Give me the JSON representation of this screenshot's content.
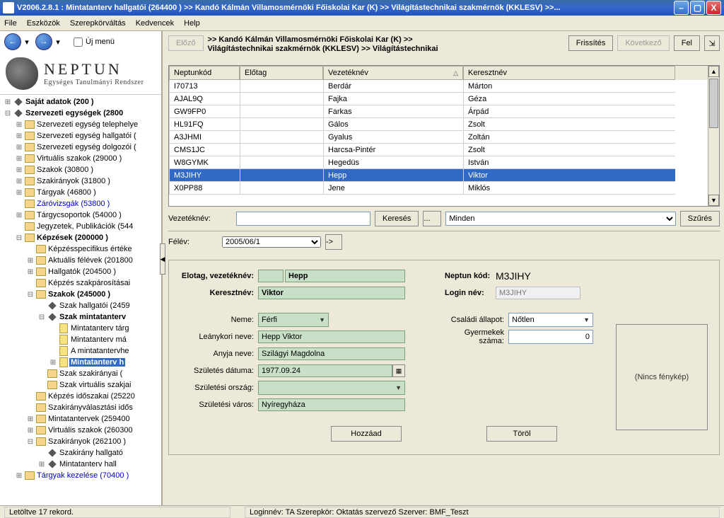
{
  "title": "V2006.2.8.1 : Mintatanterv hallgatói (264400  )   >> Kandó Kálmán Villamosmérnöki Főiskolai Kar (K) >> Világítástechnikai szakmérnök (KKLESV) >>...",
  "menu": {
    "file": "File",
    "tools": "Eszközök",
    "roles": "Szerepkörváltás",
    "fav": "Kedvencek",
    "help": "Help"
  },
  "ujmenu": "Új menü",
  "brand": {
    "name": "NEPTUN",
    "sub": "Egységes Tanulmányi Rendszer"
  },
  "toolbar": {
    "prev": "Előző",
    "refresh": "Frissítés",
    "next": "Következő",
    "up": "Fel"
  },
  "crumbs": {
    "l1": ">> Kandó Kálmán Villamosmérnöki Főiskolai Kar (K) >>",
    "l2": "Világítástechnikai szakmérnök (KKLESV) >> Világítástechnikai"
  },
  "table": {
    "cols": {
      "c0": "Neptunkód",
      "c1": "Előtag",
      "c2": "Vezetéknév",
      "c3": "Keresztnév"
    },
    "rows": [
      {
        "c0": "I70713",
        "c1": "",
        "c2": "Berdár",
        "c3": "Márton"
      },
      {
        "c0": "AJAL9Q",
        "c1": "",
        "c2": "Fajka",
        "c3": "Géza"
      },
      {
        "c0": "GW9FP0",
        "c1": "",
        "c2": "Farkas",
        "c3": "Árpád"
      },
      {
        "c0": "HL91FQ",
        "c1": "",
        "c2": "Gálos",
        "c3": "Zsolt"
      },
      {
        "c0": "A3JHMI",
        "c1": "",
        "c2": "Gyalus",
        "c3": "Zoltán"
      },
      {
        "c0": "CMS1JC",
        "c1": "",
        "c2": "Harcsa-Pintér",
        "c3": "Zsolt"
      },
      {
        "c0": "W8GYMK",
        "c1": "",
        "c2": "Hegedüs",
        "c3": "István"
      },
      {
        "c0": "M3JIHY",
        "c1": "",
        "c2": "Hepp",
        "c3": "Viktor",
        "sel": true
      },
      {
        "c0": "X0PP88",
        "c1": "",
        "c2": "Jene",
        "c3": "Miklós"
      }
    ]
  },
  "search": {
    "label": "Vezetéknév:",
    "btn": "Keresés",
    "dots": "...",
    "all": "Minden",
    "filter": "Szűrés"
  },
  "sem": {
    "label": "Félév:",
    "value": "2005/06/1",
    "go": "->"
  },
  "detail": {
    "l_elotag": "Elotag, vezetéknév:",
    "v_elotag": "",
    "v_vezetek": "Hepp",
    "l_kereszt": "Keresztnév:",
    "v_kereszt": "Viktor",
    "l_neptun": "Neptun kód:",
    "v_neptun": "M3JIHY",
    "l_login": "Login név:",
    "v_login": "M3JIHY",
    "l_neme": "Neme:",
    "v_neme": "Férfi",
    "l_csalad": "Családi állapot:",
    "v_csalad": "Nőtlen",
    "l_leany": "Leánykori neve:",
    "v_leany": "Hepp Viktor",
    "l_gyerek": "Gyermekek száma:",
    "v_gyerek": "0",
    "l_anyja": "Anyja neve:",
    "v_anyja": "Szilágyi Magdolna",
    "l_szuld": "Születés dátuma:",
    "v_szuld": "1977.09.24",
    "l_szulo": "Születési ország:",
    "v_szulo": "",
    "l_szulv": "Születési város:",
    "v_szulv": "Nyíregyháza",
    "nophoto": "(Nincs fénykép)",
    "add": "Hozzáad",
    "del": "Töröl"
  },
  "tree": [
    {
      "d": 0,
      "tw": "+",
      "ic": "diam",
      "t": "Saját adatok (200  )",
      "bold": true
    },
    {
      "d": 0,
      "tw": "-",
      "ic": "diam",
      "t": "Szervezeti egységek (2800",
      "bold": true
    },
    {
      "d": 1,
      "tw": "+",
      "ic": "fold",
      "t": "Szervezeti egység telephelye"
    },
    {
      "d": 1,
      "tw": "+",
      "ic": "fold",
      "t": "Szervezeti egység hallgatói ("
    },
    {
      "d": 1,
      "tw": "+",
      "ic": "fold",
      "t": "Szervezeti egység dolgozói ("
    },
    {
      "d": 1,
      "tw": "+",
      "ic": "fold",
      "t": "Virtuális szakok (29000  )"
    },
    {
      "d": 1,
      "tw": "+",
      "ic": "fold",
      "t": "Szakok (30800  )"
    },
    {
      "d": 1,
      "tw": "+",
      "ic": "fold",
      "t": "Szakirányok (31800  )"
    },
    {
      "d": 1,
      "tw": "+",
      "ic": "fold",
      "t": "Tárgyak (46800  )"
    },
    {
      "d": 1,
      "tw": "",
      "ic": "fold",
      "t": "Záróvizsgák (53800  )",
      "blue": true
    },
    {
      "d": 1,
      "tw": "+",
      "ic": "fold",
      "t": "Tárgycsoportok (54000  )"
    },
    {
      "d": 1,
      "tw": "",
      "ic": "fold",
      "t": "Jegyzetek, Publikációk (544"
    },
    {
      "d": 1,
      "tw": "-",
      "ic": "fold",
      "t": "Képzések (200000  )",
      "bold": true
    },
    {
      "d": 2,
      "tw": "",
      "ic": "fold",
      "t": "Képzésspecifikus értéke"
    },
    {
      "d": 2,
      "tw": "+",
      "ic": "fold",
      "t": "Aktuális félévek (201800"
    },
    {
      "d": 2,
      "tw": "+",
      "ic": "fold",
      "t": "Hallgatók (204500  )"
    },
    {
      "d": 2,
      "tw": "",
      "ic": "fold",
      "t": "Képzés szakpárosításai"
    },
    {
      "d": 2,
      "tw": "-",
      "ic": "fold",
      "t": "Szakok (245000  )",
      "bold": true
    },
    {
      "d": 3,
      "tw": "",
      "ic": "diam",
      "t": "Szak hallgatói (2459"
    },
    {
      "d": 3,
      "tw": "-",
      "ic": "diam",
      "t": "Szak mintatanterv",
      "bold": true
    },
    {
      "d": 4,
      "tw": "",
      "ic": "book",
      "t": "Mintatanterv tárg"
    },
    {
      "d": 4,
      "tw": "",
      "ic": "book",
      "t": "Mintatanterv má"
    },
    {
      "d": 4,
      "tw": "",
      "ic": "book",
      "t": "A mintatantervhe"
    },
    {
      "d": 4,
      "tw": "+",
      "ic": "book",
      "t": "Mintatanterv h",
      "sel": true
    },
    {
      "d": 3,
      "tw": "",
      "ic": "fold",
      "t": "Szak szakirányai ("
    },
    {
      "d": 3,
      "tw": "",
      "ic": "fold",
      "t": "Szak virtuális szakjai"
    },
    {
      "d": 2,
      "tw": "",
      "ic": "fold",
      "t": "Képzés időszakai (25220"
    },
    {
      "d": 2,
      "tw": "",
      "ic": "fold",
      "t": "Szakirányválasztási idős"
    },
    {
      "d": 2,
      "tw": "+",
      "ic": "fold",
      "t": "Mintatantervek (259400"
    },
    {
      "d": 2,
      "tw": "+",
      "ic": "fold",
      "t": "Virtuális szakok (260300"
    },
    {
      "d": 2,
      "tw": "-",
      "ic": "fold",
      "t": "Szakirányok (262100  )"
    },
    {
      "d": 3,
      "tw": "",
      "ic": "diam",
      "t": "Szakirány hallgató"
    },
    {
      "d": 3,
      "tw": "+",
      "ic": "diam",
      "t": "Mintatanterv hall"
    },
    {
      "d": 1,
      "tw": "+",
      "ic": "fold",
      "t": "Tárgyak kezelése (70400  )",
      "blue": true
    }
  ],
  "status": {
    "records": "Letöltve 17 rekord.",
    "login": "Loginnév: TA   Szerepkör: Oktatás szervező   Szerver: BMF_Teszt"
  }
}
